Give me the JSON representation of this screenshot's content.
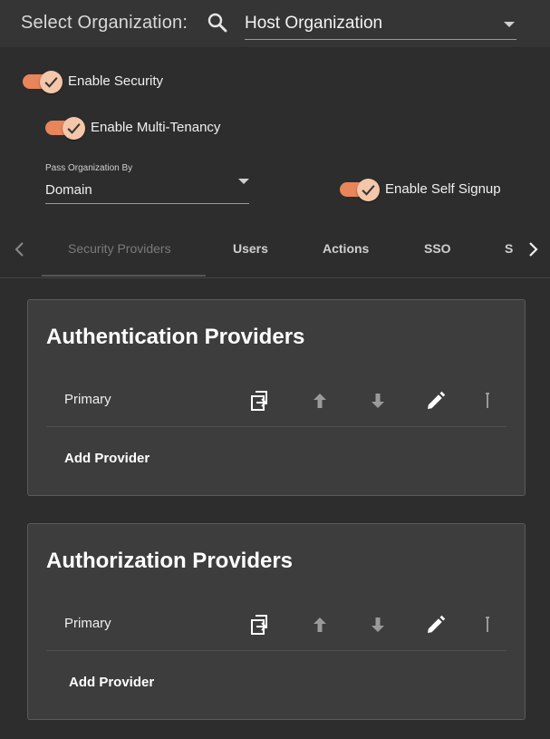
{
  "header": {
    "org_label": "Select Organization:",
    "org_selected": "Host Organization"
  },
  "toggles": {
    "enable_security": {
      "label": "Enable Security",
      "on": true
    },
    "enable_multi_tenancy": {
      "label": "Enable Multi-Tenancy",
      "on": true
    },
    "enable_self_signup": {
      "label": "Enable Self Signup",
      "on": true
    }
  },
  "pass_org": {
    "caption": "Pass Organization By",
    "value": "Domain"
  },
  "tabs": [
    {
      "label": "Security Providers",
      "active": true
    },
    {
      "label": "Users"
    },
    {
      "label": "Actions"
    },
    {
      "label": "SSO"
    },
    {
      "label": "S"
    }
  ],
  "cards": {
    "authentication": {
      "title": "Authentication Providers",
      "providers": [
        "Primary"
      ],
      "add_label": "Add Provider"
    },
    "authorization": {
      "title": "Authorization Providers",
      "providers": [
        "Primary"
      ],
      "add_label": "Add Provider"
    }
  },
  "colors": {
    "accent": "#e8855a",
    "thumb": "#f4c6aa",
    "background": "#2d2d2d",
    "card": "#3d3d3d"
  },
  "icons": {
    "row_actions": [
      "copy-icon",
      "arrow-up-icon",
      "arrow-down-icon",
      "edit-icon",
      "more-icon"
    ]
  }
}
